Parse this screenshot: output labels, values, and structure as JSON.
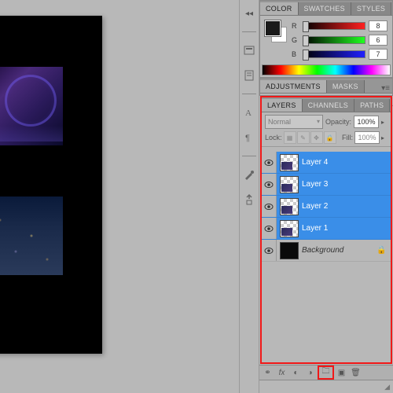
{
  "colorPanel": {
    "tabs": [
      "COLOR",
      "SWATCHES",
      "STYLES"
    ],
    "activeTab": 0,
    "channels": {
      "r": {
        "label": "R",
        "value": "8",
        "pos": 3
      },
      "g": {
        "label": "G",
        "value": "6",
        "pos": 2
      },
      "b": {
        "label": "B",
        "value": "7",
        "pos": 3
      }
    }
  },
  "adjPanel": {
    "tabs": [
      "ADJUSTMENTS",
      "MASKS"
    ],
    "activeTab": 0
  },
  "layersPanel": {
    "tabs": [
      "LAYERS",
      "CHANNELS",
      "PATHS"
    ],
    "activeTab": 0,
    "blendMode": "Normal",
    "opacityLabel": "Opacity:",
    "opacity": "100%",
    "lockLabel": "Lock:",
    "fillLabel": "Fill:",
    "fill": "100%",
    "layers": [
      {
        "name": "Layer 4",
        "visible": true,
        "selected": true,
        "thumb": "img"
      },
      {
        "name": "Layer 3",
        "visible": true,
        "selected": true,
        "thumb": "img"
      },
      {
        "name": "Layer 2",
        "visible": true,
        "selected": true,
        "thumb": "img"
      },
      {
        "name": "Layer 1",
        "visible": true,
        "selected": true,
        "thumb": "img"
      },
      {
        "name": "Background",
        "visible": true,
        "selected": false,
        "thumb": "black",
        "locked": true,
        "bg": true
      }
    ]
  }
}
